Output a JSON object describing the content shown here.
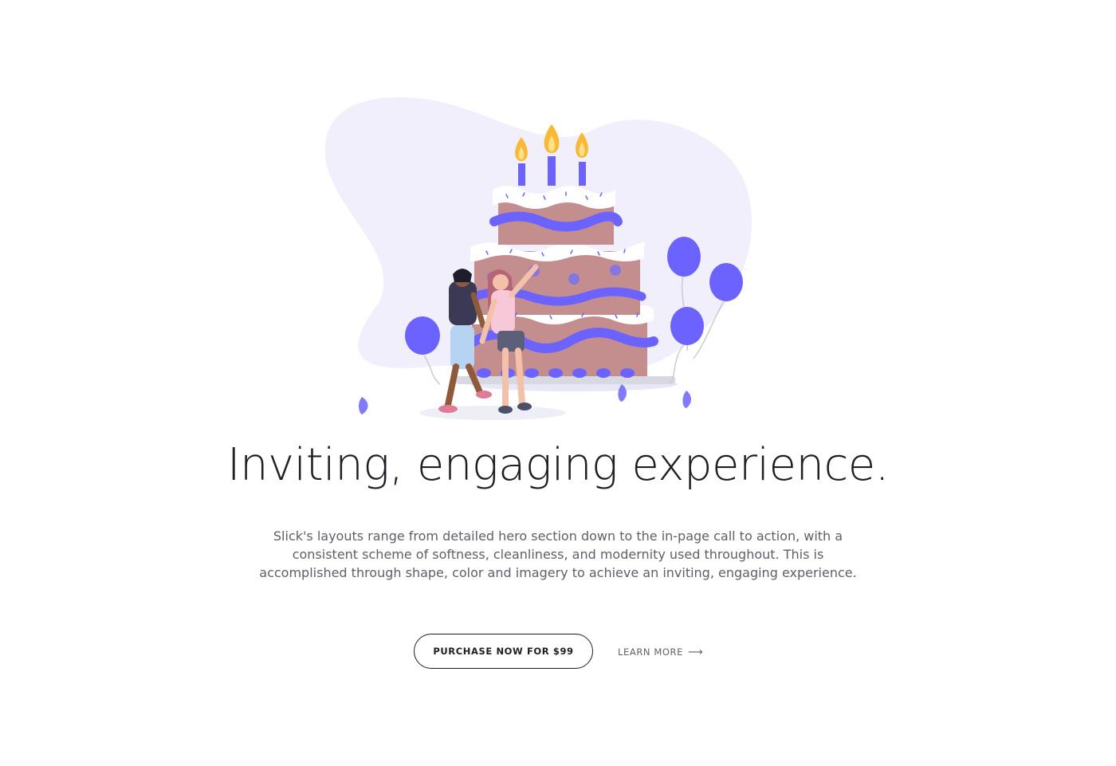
{
  "hero": {
    "title": "Inviting, engaging experience.",
    "description": "Slick's layouts range from detailed hero section down to the in-page call to action, with a consistent scheme of softness, cleanliness, and modernity used throughout. This is accomplished through shape, color and imagery to achieve an inviting, engaging experience.",
    "illustration": "birthday-cake-celebration-illustration"
  },
  "cta": {
    "purchase_label": "PURCHASE NOW FOR $99",
    "learn_more_label": "LEARN MORE",
    "learn_more_icon": "long-arrow-right-icon"
  },
  "colors": {
    "accent": "#6c63ff",
    "cake": "#c48e8e",
    "blob": "#f0effb",
    "text": "#1e1e24",
    "muted": "#5f5f69"
  }
}
